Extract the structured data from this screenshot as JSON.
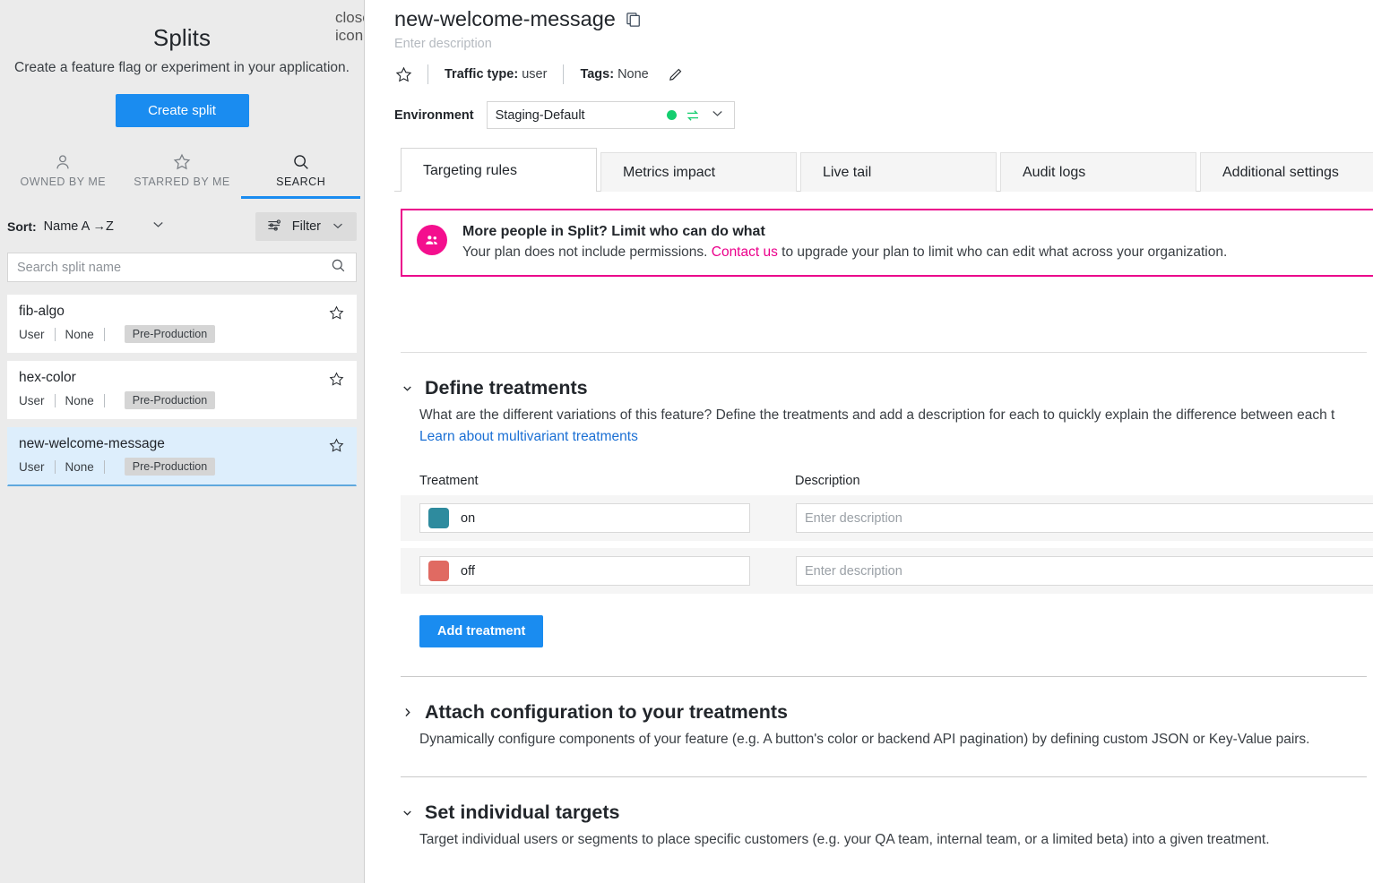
{
  "sidebar": {
    "close_icon": "close-icon",
    "title": "Splits",
    "subtitle": "Create a feature flag or experiment in your application.",
    "create_button": "Create split",
    "tabs": [
      {
        "label": "OWNED BY ME",
        "icon": "user-icon",
        "active": false
      },
      {
        "label": "STARRED BY ME",
        "icon": "star-icon",
        "active": false
      },
      {
        "label": "SEARCH",
        "icon": "search-icon",
        "active": true
      }
    ],
    "sort_label": "Sort:",
    "sort_value": "Name A →Z",
    "filter_label": "Filter",
    "search_placeholder": "Search split name",
    "search_value": "",
    "splits": [
      {
        "name": "fib-algo",
        "traffic": "User",
        "tags": "None",
        "env": "Pre-Production",
        "selected": false
      },
      {
        "name": "hex-color",
        "traffic": "User",
        "tags": "None",
        "env": "Pre-Production",
        "selected": false
      },
      {
        "name": "new-welcome-message",
        "traffic": "User",
        "tags": "None",
        "env": "Pre-Production",
        "selected": true
      }
    ]
  },
  "main": {
    "title": "new-welcome-message",
    "description_placeholder": "Enter description",
    "traffic_type_label": "Traffic type:",
    "traffic_type_value": "user",
    "tags_label": "Tags:",
    "tags_value": "None",
    "environment_label": "Environment",
    "environment_value": "Staging-Default",
    "tabs": [
      {
        "label": "Targeting rules",
        "active": true
      },
      {
        "label": "Metrics impact",
        "active": false
      },
      {
        "label": "Live tail",
        "active": false
      },
      {
        "label": "Audit logs",
        "active": false
      },
      {
        "label": "Additional settings",
        "active": false
      }
    ],
    "banner": {
      "heading": "More people in Split? Limit who can do what",
      "body_before": "Your plan does not include permissions. ",
      "link": "Contact us",
      "body_after": " to upgrade your plan to limit who can edit what across your organization.",
      "accent": "#eb008b"
    },
    "define_treatments": {
      "title": "Define treatments",
      "description": "What are the different variations of this feature? Define the treatments and add a description for each to quickly explain the difference between each t",
      "link": "Learn about multivariant treatments",
      "col_treatment": "Treatment",
      "col_description": "Description",
      "rows": [
        {
          "name": "on",
          "color": "#2e8b9e",
          "desc_value": "",
          "desc_placeholder": "Enter description"
        },
        {
          "name": "off",
          "color": "#e06a62",
          "desc_value": "",
          "desc_placeholder": "Enter description"
        }
      ],
      "add_button": "Add treatment"
    },
    "attach_configuration": {
      "title": "Attach configuration to your treatments",
      "description": "Dynamically configure components of your feature (e.g. A button's color or backend API pagination) by defining custom JSON or Key-Value pairs."
    },
    "individual_targets": {
      "title": "Set individual targets",
      "description": "Target individual users or segments to place specific customers (e.g. your QA team, internal team, or a limited beta) into a given treatment."
    }
  },
  "colors": {
    "primary": "#1a8cf0",
    "accent_pink": "#eb008b",
    "status_green": "#14ce6f"
  }
}
